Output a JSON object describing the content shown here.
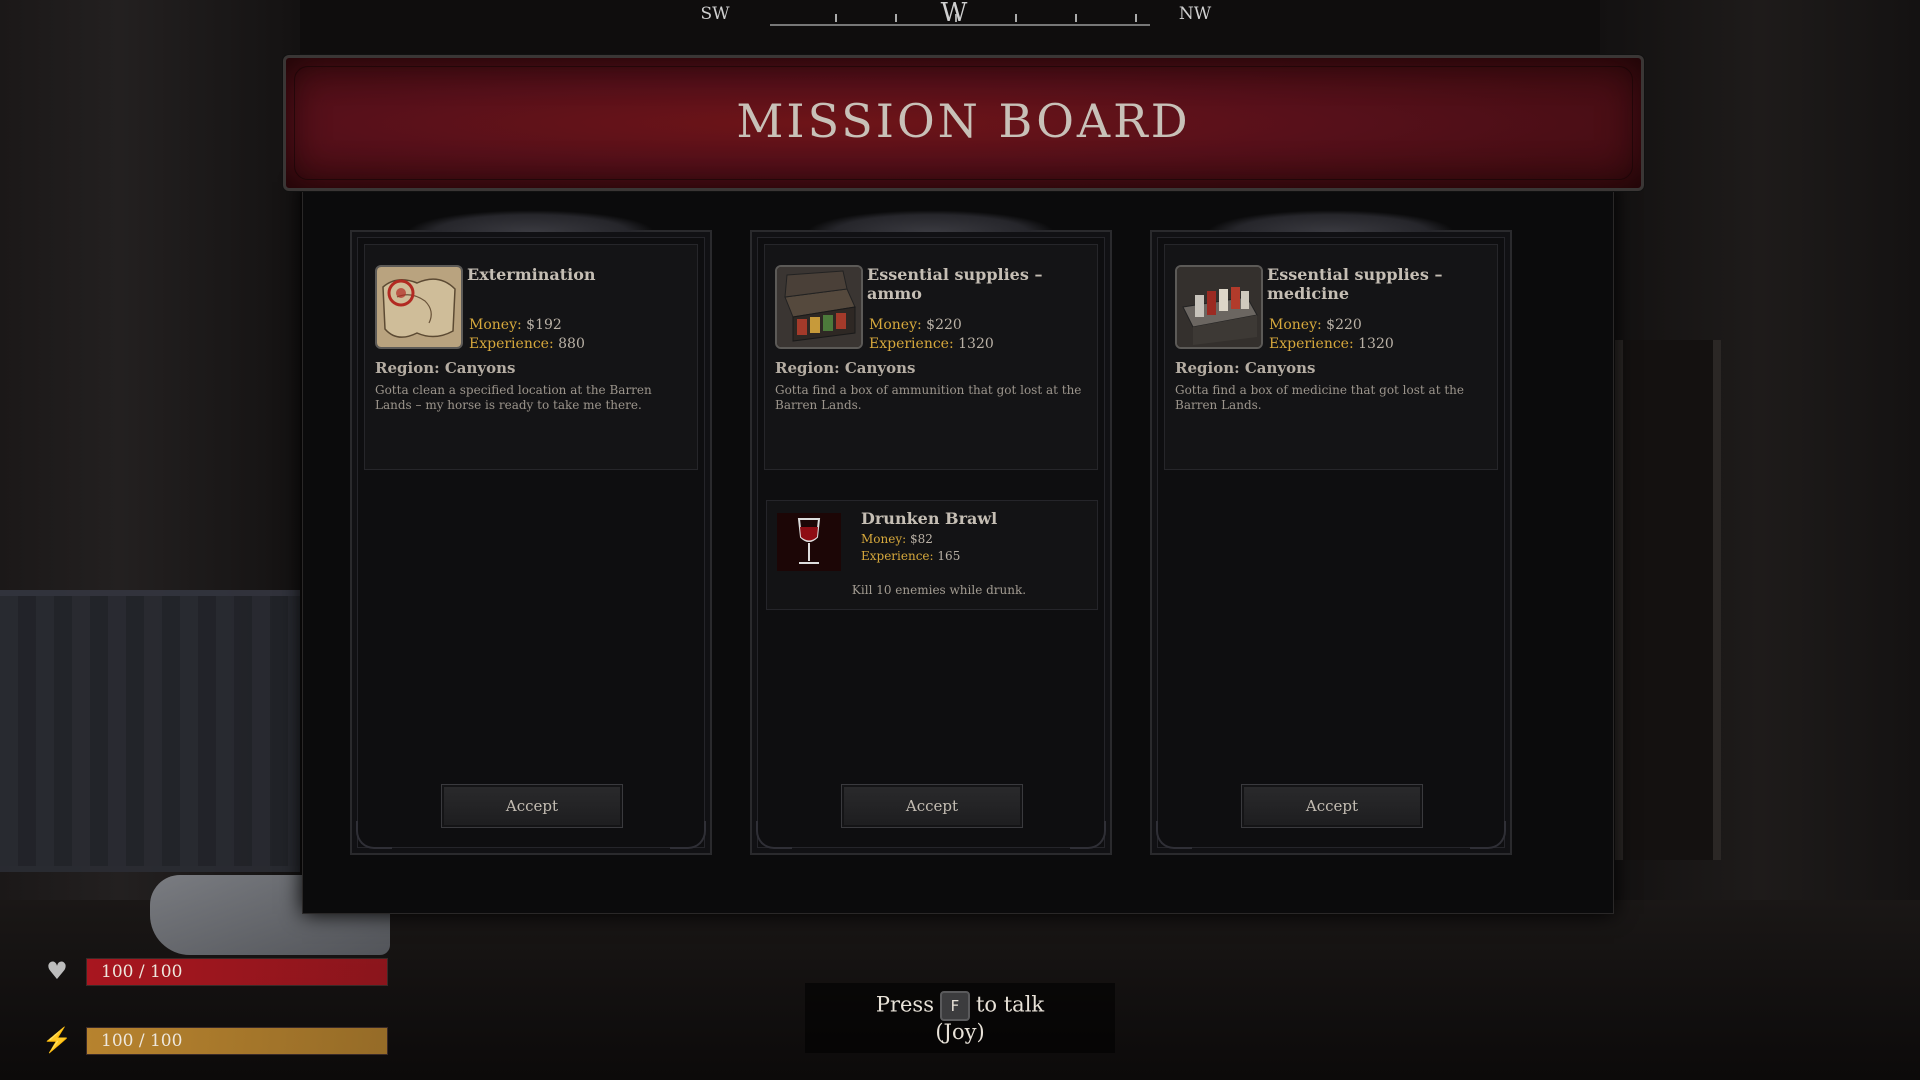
{
  "compass": {
    "left": "SW",
    "center": "W",
    "right": "NW"
  },
  "board": {
    "title": "MISSION BOARD",
    "accept_label": "Accept",
    "missions": [
      {
        "title": "Extermination",
        "money_label": "Money:",
        "money": "$192",
        "experience_label": "Experience:",
        "experience": "880",
        "region": "Region: Canyons",
        "description": "Gotta clean a specified location at the Barren Lands – my horse is ready to take me there.",
        "icon": "map-icon"
      },
      {
        "title": "Essential supplies – ammo",
        "money_label": "Money:",
        "money": "$220",
        "experience_label": "Experience:",
        "experience": "1320",
        "region": "Region: Canyons",
        "description": "Gotta find a box of ammunition that got lost at the Barren Lands.",
        "icon": "ammo-box-icon"
      },
      {
        "title": "Essential supplies – medicine",
        "money_label": "Money:",
        "money": "$220",
        "experience_label": "Experience:",
        "experience": "1320",
        "region": "Region: Canyons",
        "description": "Gotta find a box of medicine that got lost at the Barren Lands.",
        "icon": "medicine-box-icon"
      }
    ],
    "challenge": {
      "title": "Drunken Brawl",
      "money_label": "Money:",
      "money": "$82",
      "experience_label": "Experience:",
      "experience": "165",
      "description": "Kill 10 enemies while drunk.",
      "icon": "wine-glass-icon"
    }
  },
  "hud": {
    "health": {
      "text": "100 / 100",
      "fraction": 1.0,
      "color": "#a8161f",
      "icon": "heart-icon"
    },
    "stamina": {
      "text": "100 / 100",
      "fraction": 1.0,
      "color": "#b7832e",
      "icon": "lightning-icon"
    }
  },
  "prompt": {
    "press": "Press",
    "key": "F",
    "action": "to talk",
    "target": "(Joy)"
  }
}
